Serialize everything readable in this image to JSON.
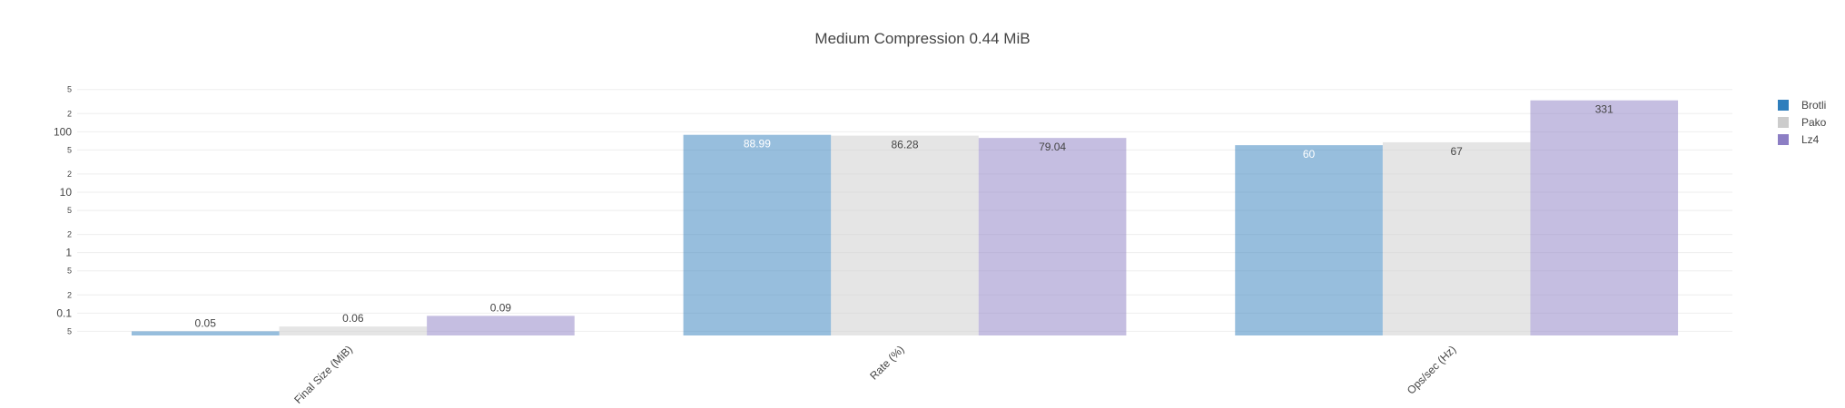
{
  "colors": {
    "brotli": "#2f7ebc",
    "pako": "#cccccc",
    "lz4": "#8c7ec4",
    "bar_opacity": 0.5,
    "grid": "#eeeeee",
    "axis_text": "#444444"
  },
  "chart_data": {
    "type": "bar",
    "title": "Medium Compression 0.44 MiB",
    "xlabel": "",
    "ylabel": "",
    "y_scale": "log",
    "ylim_log10": [
      -1.37,
      2.8
    ],
    "categories": [
      "Final Size (MiB)",
      "Rate (%)",
      "Ops/sec (Hz)"
    ],
    "series": [
      {
        "name": "Brotli",
        "color": "#2f7ebc",
        "values": [
          0.05,
          88.99,
          60
        ],
        "labels": [
          "0.05",
          "88.99",
          "60"
        ]
      },
      {
        "name": "Pako",
        "color": "#cccccc",
        "values": [
          0.06,
          86.28,
          67
        ],
        "labels": [
          "0.06",
          "86.28",
          "67"
        ]
      },
      {
        "name": "Lz4",
        "color": "#8c7ec4",
        "values": [
          0.09,
          79.04,
          331
        ],
        "labels": [
          "0.09",
          "79.04",
          "331"
        ]
      }
    ],
    "y_ticks": [
      {
        "value": 0.05,
        "label": "5",
        "major": false
      },
      {
        "value": 0.1,
        "label": "0.1",
        "major": true
      },
      {
        "value": 0.2,
        "label": "2",
        "major": false
      },
      {
        "value": 0.5,
        "label": "5",
        "major": false
      },
      {
        "value": 1,
        "label": "1",
        "major": true
      },
      {
        "value": 2,
        "label": "2",
        "major": false
      },
      {
        "value": 5,
        "label": "5",
        "major": false
      },
      {
        "value": 10,
        "label": "10",
        "major": true
      },
      {
        "value": 20,
        "label": "2",
        "major": false
      },
      {
        "value": 50,
        "label": "5",
        "major": false
      },
      {
        "value": 100,
        "label": "100",
        "major": true
      },
      {
        "value": 200,
        "label": "2",
        "major": false
      },
      {
        "value": 500,
        "label": "5",
        "major": false
      }
    ],
    "grid": true,
    "legend_position": "top-right"
  }
}
